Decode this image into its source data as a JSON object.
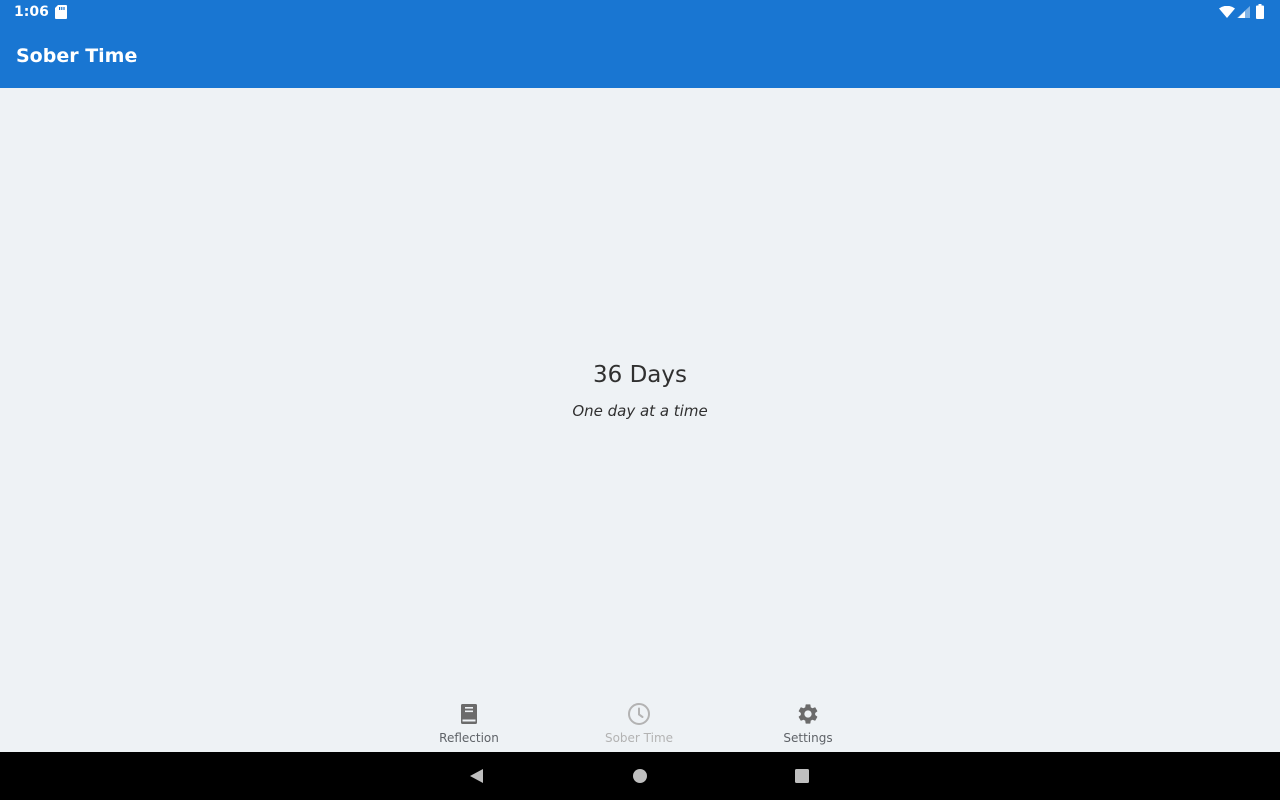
{
  "status_bar": {
    "time": "1:06",
    "icons": [
      "sd-card-icon",
      "wifi-icon",
      "cell-signal-icon",
      "battery-icon"
    ]
  },
  "app_bar": {
    "title": "Sober Time",
    "color": "#1976d2"
  },
  "main": {
    "days_count": "36 Days",
    "tagline": "One day at a time"
  },
  "bottom_nav": {
    "items": [
      {
        "label": "Reflection",
        "icon": "book-icon",
        "active": false
      },
      {
        "label": "Sober Time",
        "icon": "clock-icon",
        "active": true
      },
      {
        "label": "Settings",
        "icon": "gear-icon",
        "active": false
      }
    ],
    "inactive_color": "#5f6368",
    "active_color": "#b3b3b3"
  },
  "system_nav": {
    "buttons": [
      "back-icon",
      "home-icon",
      "recents-icon"
    ]
  },
  "colors": {
    "background": "#eef2f5",
    "text": "#303030"
  }
}
